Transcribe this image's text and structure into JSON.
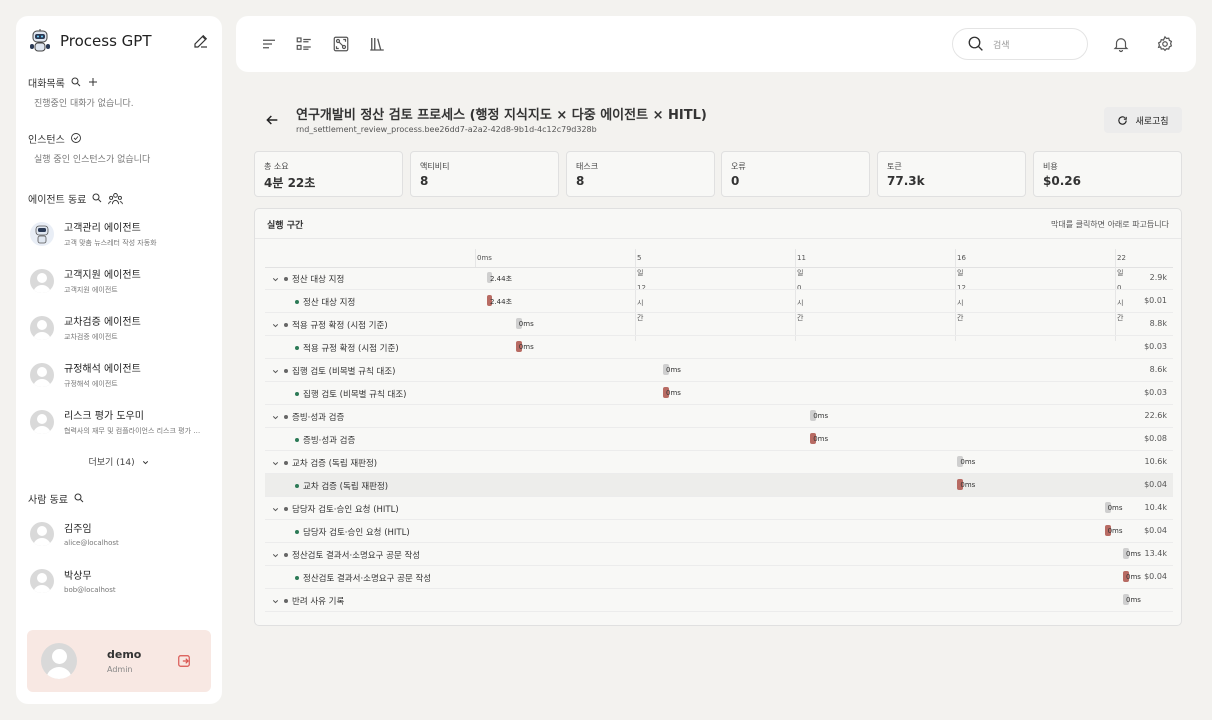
{
  "sidebar": {
    "app_name": "Process GPT",
    "chats": {
      "title": "대화목록",
      "empty": "진행중인 대화가 없습니다."
    },
    "instances": {
      "title": "인스턴스",
      "empty": "실행 중인 인스턴스가 없습니다"
    },
    "agents": {
      "title": "에이전트 동료",
      "items": [
        {
          "name": "고객관리 에이전트",
          "desc": "고객 맞춤 뉴스레터 작성 자동화"
        },
        {
          "name": "고객지원 에이전트",
          "desc": "고객지원 에이전트"
        },
        {
          "name": "교차검증 에이전트",
          "desc": "교차검증 에이전트"
        },
        {
          "name": "규정해석 에이전트",
          "desc": "규정해석 에이전트"
        },
        {
          "name": "리스크 평가 도우미",
          "desc": "협력사의 재무 및 컴플라이언스 리스크 평가 도우미"
        }
      ],
      "more": "더보기 (14)"
    },
    "people": {
      "title": "사람 동료",
      "items": [
        {
          "name": "김주임",
          "email": "alice@localhost"
        },
        {
          "name": "박상무",
          "email": "bob@localhost"
        }
      ]
    },
    "user": {
      "name": "demo",
      "role": "Admin"
    }
  },
  "topbar": {
    "search_placeholder": "검색"
  },
  "header": {
    "title": "연구개발비 정산 검토 프로세스 (행정 지식지도 × 다중 에이전트 × HITL)",
    "process_id": "rnd_settlement_review_process.bee26dd7-a2a2-42d8-9b1d-4c12c79d328b",
    "refresh_label": "새로고침"
  },
  "stats": [
    {
      "label": "총 소요",
      "value": "4분 22초"
    },
    {
      "label": "액티비티",
      "value": "8"
    },
    {
      "label": "태스크",
      "value": "8"
    },
    {
      "label": "오류",
      "value": "0"
    },
    {
      "label": "토큰",
      "value": "77.3k"
    },
    {
      "label": "비용",
      "value": "$0.26"
    }
  ],
  "spans": {
    "title": "실행 구간",
    "hint": "막대를 클릭하면 아래로 파고듭니다",
    "ticks": [
      "0ms",
      "5\n일\n12\n시\n간",
      "11\n일\n0\n시\n간",
      "16\n일\n12\n시\n간",
      "22\n일\n0\n시\n간"
    ],
    "rows": [
      {
        "label": "정산 대상 지정",
        "level": 0,
        "bar": "2.44초",
        "pos": 0.0,
        "metric": "2.9k"
      },
      {
        "label": "정산 대상 지정",
        "level": 1,
        "bar": "2.44초",
        "pos": 0.0,
        "metric": "$0.01"
      },
      {
        "label": "적용 규정 확정 (시점 기준)",
        "level": 0,
        "bar": "0ms",
        "pos": 0.045,
        "metric": "8.8k"
      },
      {
        "label": "적용 규정 확정 (시점 기준)",
        "level": 1,
        "bar": "0ms",
        "pos": 0.045,
        "metric": "$0.03"
      },
      {
        "label": "집행 검토 (비목별 규칙 대조)",
        "level": 0,
        "bar": "0ms",
        "pos": 0.275,
        "metric": "8.6k"
      },
      {
        "label": "집행 검토 (비목별 규칙 대조)",
        "level": 1,
        "bar": "0ms",
        "pos": 0.275,
        "metric": "$0.03"
      },
      {
        "label": "증빙·성과 검증",
        "level": 0,
        "bar": "0ms",
        "pos": 0.505,
        "metric": "22.6k"
      },
      {
        "label": "증빙·성과 검증",
        "level": 1,
        "bar": "0ms",
        "pos": 0.505,
        "metric": "$0.08"
      },
      {
        "label": "교차 검증 (독립 재판정)",
        "level": 0,
        "bar": "0ms",
        "pos": 0.735,
        "metric": "10.6k"
      },
      {
        "label": "교차 검증 (독립 재판정)",
        "level": 1,
        "bar": "0ms",
        "pos": 0.735,
        "metric": "$0.04"
      },
      {
        "label": "담당자 검토·승인 요청 (HITL)",
        "level": 0,
        "bar": "0ms",
        "pos": 0.965,
        "metric": "10.4k"
      },
      {
        "label": "담당자 검토·승인 요청 (HITL)",
        "level": 1,
        "bar": "0ms",
        "pos": 0.965,
        "metric": "$0.04"
      },
      {
        "label": "정산검토 결과서·소명요구 공문 작성",
        "level": 0,
        "bar": "0ms",
        "pos": 1.01,
        "metric": "13.4k"
      },
      {
        "label": "정산검토 결과서·소명요구 공문 작성",
        "level": 1,
        "bar": "0ms",
        "pos": 1.01,
        "metric": "$0.04"
      },
      {
        "label": "반려 사유 기록",
        "level": 0,
        "bar": "0ms",
        "pos": 1.01,
        "metric": ""
      }
    ]
  }
}
